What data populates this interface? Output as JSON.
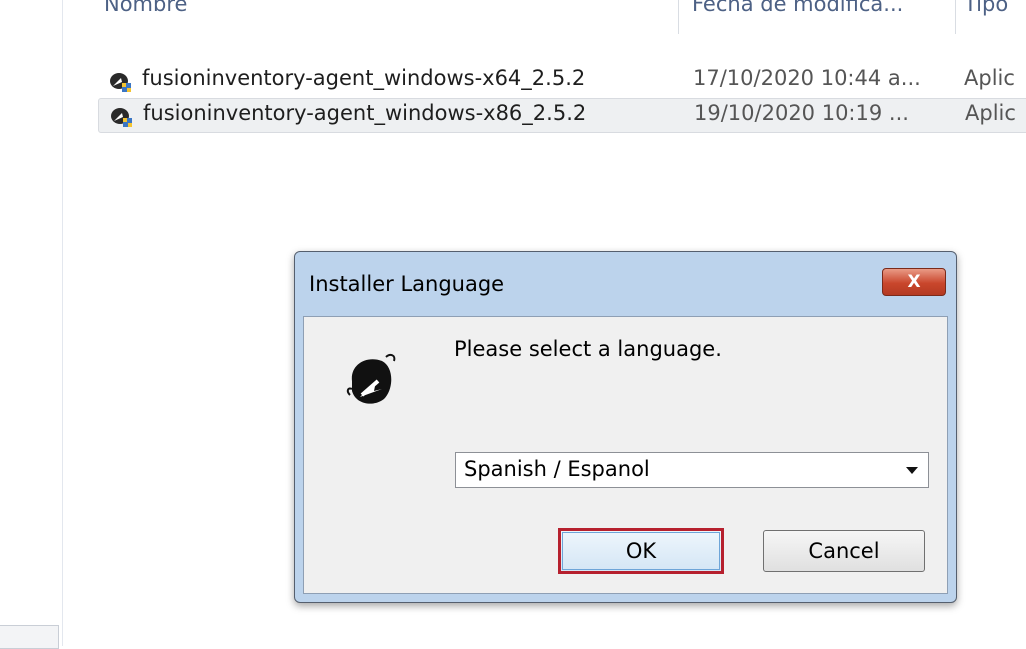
{
  "explorer": {
    "columns": {
      "name": "Nombre",
      "date": "Fecha de modifica...",
      "type": "Tipo"
    },
    "files": [
      {
        "name": "fusioninventory-agent_windows-x64_2.5.2",
        "date": "17/10/2020 10:44 a...",
        "type": "Aplic",
        "selected": false
      },
      {
        "name": "fusioninventory-agent_windows-x86_2.5.2",
        "date": "19/10/2020 10:19 ...",
        "type": "Aplic",
        "selected": true
      }
    ]
  },
  "dialog": {
    "title": "Installer Language",
    "close_label": "X",
    "prompt": "Please select a language.",
    "language_selected": "Spanish / Espanol",
    "ok_label": "OK",
    "cancel_label": "Cancel",
    "icon": "installer-app-icon"
  },
  "colors": {
    "dialog_frame": "#bcd3ec",
    "close_button": "#c9462c",
    "ok_focus_border": "#b6202e",
    "header_text": "#4d6185"
  }
}
